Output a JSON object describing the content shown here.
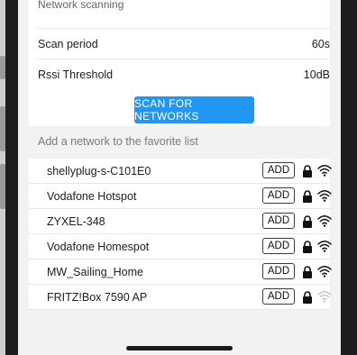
{
  "section": {
    "title": "Network scanning"
  },
  "settings": [
    {
      "label": "Scan period",
      "value": "60s"
    },
    {
      "label": "Rssi Threshold",
      "value": "10dB"
    }
  ],
  "scan_button": {
    "label": "SCAN FOR NETWORKS"
  },
  "favorites": {
    "header": "Add a network to the favorite list",
    "add_label": "ADD"
  },
  "networks": [
    {
      "name": "shellyplug-s-C101E0",
      "locked": true,
      "signal": "strong"
    },
    {
      "name": "Vodafone Hotspot",
      "locked": true,
      "signal": "strong"
    },
    {
      "name": "ZYXEL-348",
      "locked": true,
      "signal": "strong"
    },
    {
      "name": "Vodafone Homespot",
      "locked": true,
      "signal": "strong"
    },
    {
      "name": "MW_Sailing_Home",
      "locked": true,
      "signal": "strong"
    },
    {
      "name": "FRITZ!Box 7590 AP",
      "locked": true,
      "signal": "weak"
    }
  ],
  "colors": {
    "accent": "#2196f3",
    "background": "#f2f2f2"
  }
}
